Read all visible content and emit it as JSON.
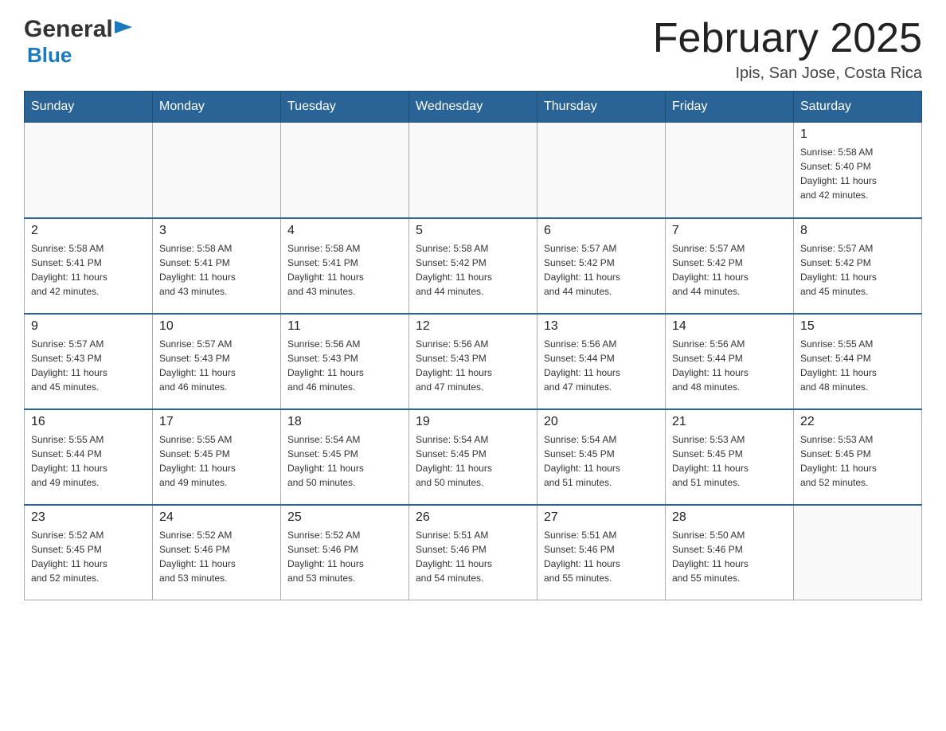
{
  "logo": {
    "general": "General",
    "blue": "Blue",
    "triangle": "▶"
  },
  "header": {
    "month_title": "February 2025",
    "location": "Ipis, San Jose, Costa Rica"
  },
  "days_of_week": [
    "Sunday",
    "Monday",
    "Tuesday",
    "Wednesday",
    "Thursday",
    "Friday",
    "Saturday"
  ],
  "weeks": [
    [
      {
        "day": "",
        "info": ""
      },
      {
        "day": "",
        "info": ""
      },
      {
        "day": "",
        "info": ""
      },
      {
        "day": "",
        "info": ""
      },
      {
        "day": "",
        "info": ""
      },
      {
        "day": "",
        "info": ""
      },
      {
        "day": "1",
        "info": "Sunrise: 5:58 AM\nSunset: 5:40 PM\nDaylight: 11 hours\nand 42 minutes."
      }
    ],
    [
      {
        "day": "2",
        "info": "Sunrise: 5:58 AM\nSunset: 5:41 PM\nDaylight: 11 hours\nand 42 minutes."
      },
      {
        "day": "3",
        "info": "Sunrise: 5:58 AM\nSunset: 5:41 PM\nDaylight: 11 hours\nand 43 minutes."
      },
      {
        "day": "4",
        "info": "Sunrise: 5:58 AM\nSunset: 5:41 PM\nDaylight: 11 hours\nand 43 minutes."
      },
      {
        "day": "5",
        "info": "Sunrise: 5:58 AM\nSunset: 5:42 PM\nDaylight: 11 hours\nand 44 minutes."
      },
      {
        "day": "6",
        "info": "Sunrise: 5:57 AM\nSunset: 5:42 PM\nDaylight: 11 hours\nand 44 minutes."
      },
      {
        "day": "7",
        "info": "Sunrise: 5:57 AM\nSunset: 5:42 PM\nDaylight: 11 hours\nand 44 minutes."
      },
      {
        "day": "8",
        "info": "Sunrise: 5:57 AM\nSunset: 5:42 PM\nDaylight: 11 hours\nand 45 minutes."
      }
    ],
    [
      {
        "day": "9",
        "info": "Sunrise: 5:57 AM\nSunset: 5:43 PM\nDaylight: 11 hours\nand 45 minutes."
      },
      {
        "day": "10",
        "info": "Sunrise: 5:57 AM\nSunset: 5:43 PM\nDaylight: 11 hours\nand 46 minutes."
      },
      {
        "day": "11",
        "info": "Sunrise: 5:56 AM\nSunset: 5:43 PM\nDaylight: 11 hours\nand 46 minutes."
      },
      {
        "day": "12",
        "info": "Sunrise: 5:56 AM\nSunset: 5:43 PM\nDaylight: 11 hours\nand 47 minutes."
      },
      {
        "day": "13",
        "info": "Sunrise: 5:56 AM\nSunset: 5:44 PM\nDaylight: 11 hours\nand 47 minutes."
      },
      {
        "day": "14",
        "info": "Sunrise: 5:56 AM\nSunset: 5:44 PM\nDaylight: 11 hours\nand 48 minutes."
      },
      {
        "day": "15",
        "info": "Sunrise: 5:55 AM\nSunset: 5:44 PM\nDaylight: 11 hours\nand 48 minutes."
      }
    ],
    [
      {
        "day": "16",
        "info": "Sunrise: 5:55 AM\nSunset: 5:44 PM\nDaylight: 11 hours\nand 49 minutes."
      },
      {
        "day": "17",
        "info": "Sunrise: 5:55 AM\nSunset: 5:45 PM\nDaylight: 11 hours\nand 49 minutes."
      },
      {
        "day": "18",
        "info": "Sunrise: 5:54 AM\nSunset: 5:45 PM\nDaylight: 11 hours\nand 50 minutes."
      },
      {
        "day": "19",
        "info": "Sunrise: 5:54 AM\nSunset: 5:45 PM\nDaylight: 11 hours\nand 50 minutes."
      },
      {
        "day": "20",
        "info": "Sunrise: 5:54 AM\nSunset: 5:45 PM\nDaylight: 11 hours\nand 51 minutes."
      },
      {
        "day": "21",
        "info": "Sunrise: 5:53 AM\nSunset: 5:45 PM\nDaylight: 11 hours\nand 51 minutes."
      },
      {
        "day": "22",
        "info": "Sunrise: 5:53 AM\nSunset: 5:45 PM\nDaylight: 11 hours\nand 52 minutes."
      }
    ],
    [
      {
        "day": "23",
        "info": "Sunrise: 5:52 AM\nSunset: 5:45 PM\nDaylight: 11 hours\nand 52 minutes."
      },
      {
        "day": "24",
        "info": "Sunrise: 5:52 AM\nSunset: 5:46 PM\nDaylight: 11 hours\nand 53 minutes."
      },
      {
        "day": "25",
        "info": "Sunrise: 5:52 AM\nSunset: 5:46 PM\nDaylight: 11 hours\nand 53 minutes."
      },
      {
        "day": "26",
        "info": "Sunrise: 5:51 AM\nSunset: 5:46 PM\nDaylight: 11 hours\nand 54 minutes."
      },
      {
        "day": "27",
        "info": "Sunrise: 5:51 AM\nSunset: 5:46 PM\nDaylight: 11 hours\nand 55 minutes."
      },
      {
        "day": "28",
        "info": "Sunrise: 5:50 AM\nSunset: 5:46 PM\nDaylight: 11 hours\nand 55 minutes."
      },
      {
        "day": "",
        "info": ""
      }
    ]
  ]
}
